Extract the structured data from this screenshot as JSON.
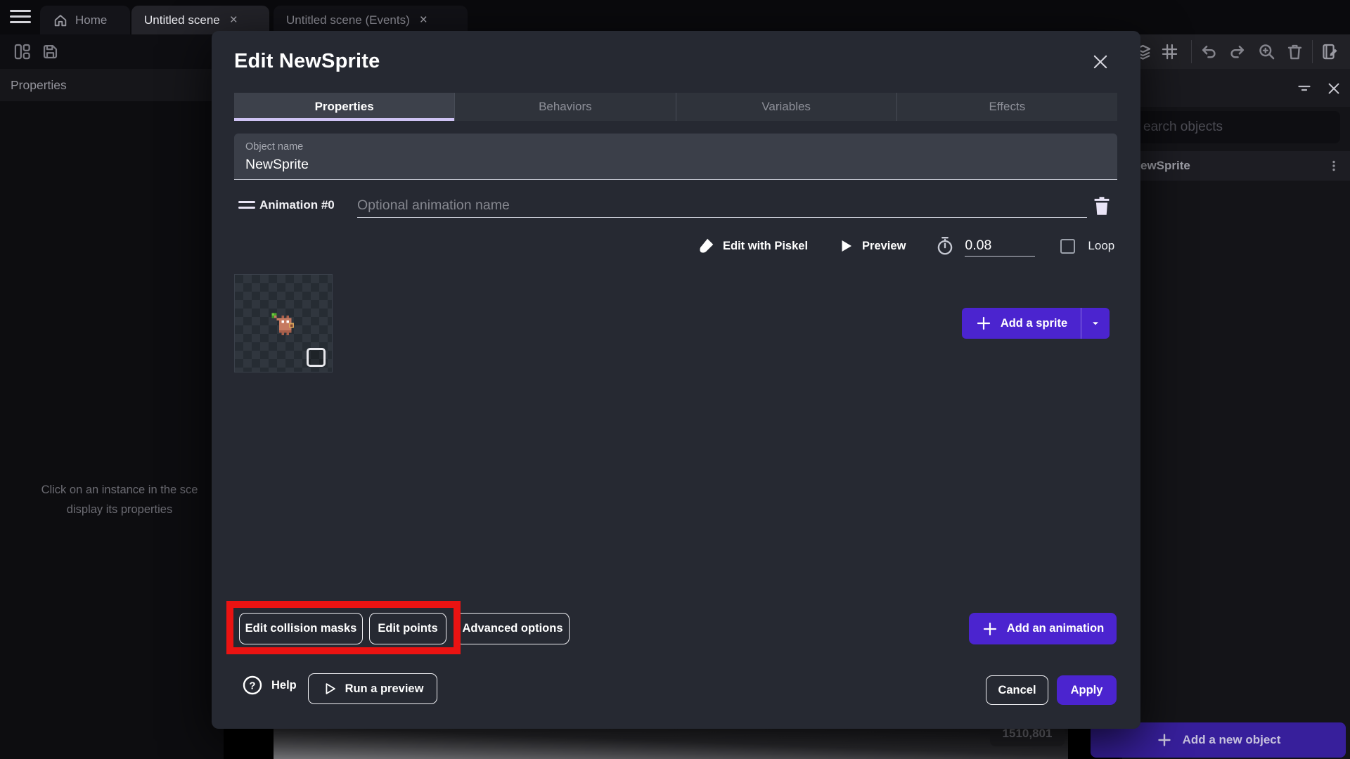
{
  "window": {
    "tabs": [
      {
        "label": "Home"
      },
      {
        "label": "Untitled scene"
      },
      {
        "label": "Untitled scene (Events)"
      }
    ],
    "close_glyph": "×"
  },
  "toolbar": {
    "left_icons": [
      "layout-columns",
      "save"
    ],
    "right_icons": [
      "layers",
      "grid",
      "undo",
      "redo",
      "zoom-in",
      "trash",
      "edit-scene-properties"
    ]
  },
  "left_panel": {
    "header": "Properties",
    "empty_line1": "Click on an instance in the sce",
    "empty_line2": "display its properties"
  },
  "right_panel": {
    "header_icons": [
      "filter",
      "close"
    ],
    "search_placeholder": "earch objects",
    "object_name": "ewSprite",
    "add_new_object_label": "Add a new object"
  },
  "canvas": {
    "coords_badge": "1510,801"
  },
  "dialog": {
    "title": "Edit NewSprite",
    "tabs": [
      {
        "label": "Properties",
        "active": true
      },
      {
        "label": "Behaviors"
      },
      {
        "label": "Variables"
      },
      {
        "label": "Effects"
      }
    ],
    "object_name": {
      "label": "Object name",
      "value": "NewSprite"
    },
    "animation": {
      "label": "Animation #0",
      "name_placeholder": "Optional animation name",
      "edit_with_piskel_label": "Edit with Piskel",
      "preview_label": "Preview",
      "time_between_frames": "0.08",
      "loop_label": "Loop"
    },
    "add_sprite_label": "Add a sprite",
    "edit_collision_masks_label": "Edit collision masks",
    "edit_points_label": "Edit points",
    "advanced_options_label": "Advanced options",
    "add_animation_label": "Add an animation",
    "help_label": "Help",
    "run_preview_label": "Run a preview",
    "cancel_label": "Cancel",
    "apply_label": "Apply"
  },
  "colors": {
    "accent_purple": "#4b24cf",
    "dimmed_purple": "#371f9b",
    "annotation_red": "#ea1312",
    "tab_underline": "#cfc3f4",
    "dialog_bg": "#262932"
  }
}
